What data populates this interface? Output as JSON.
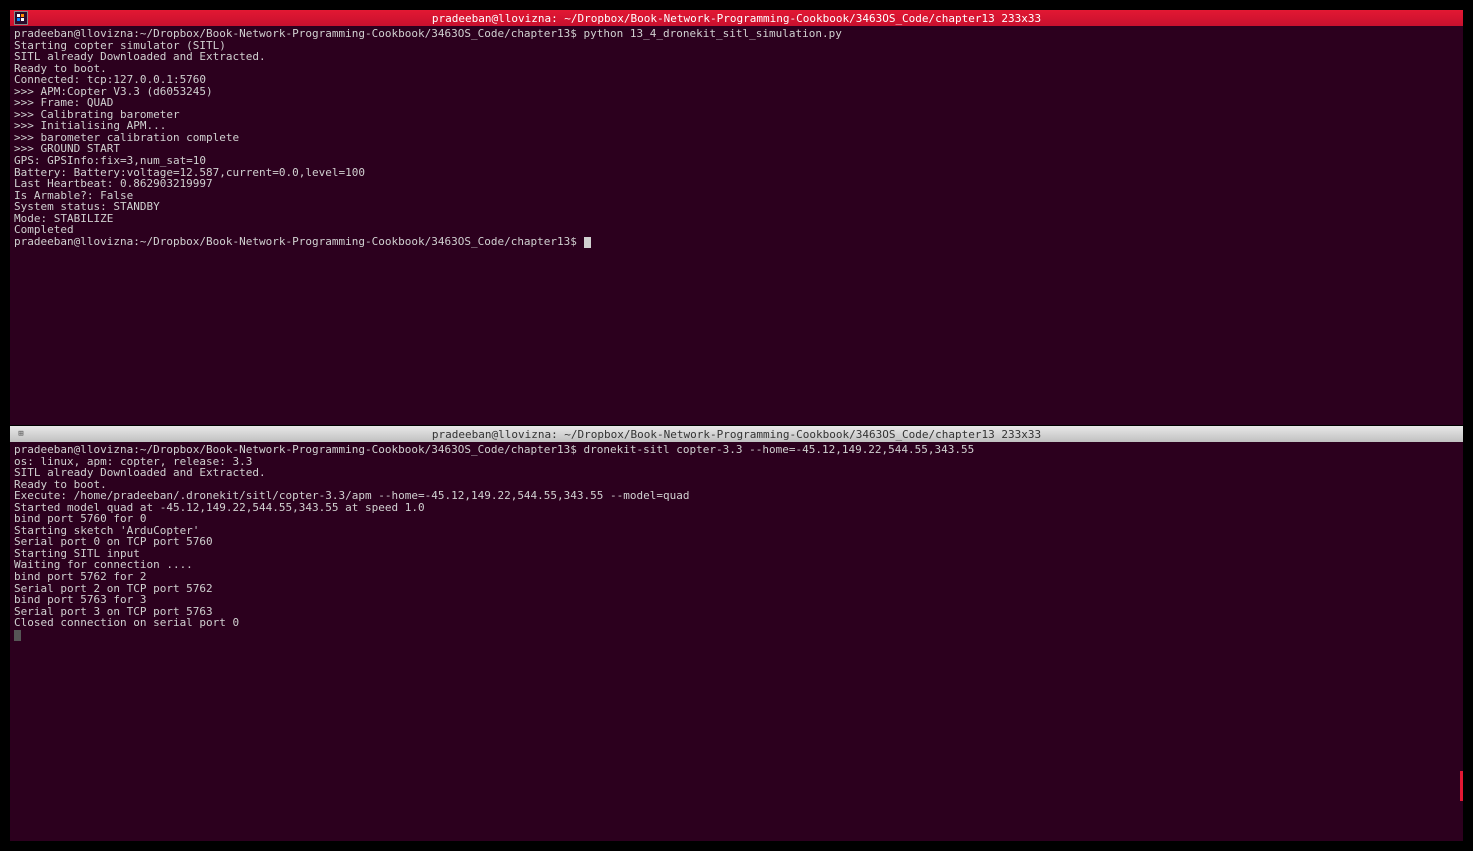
{
  "topPane": {
    "title": "pradeeban@llovizna: ~/Dropbox/Book-Network-Programming-Cookbook/3463OS_Code/chapter13 233x33",
    "promptLine": "pradeeban@llovizna:~/Dropbox/Book-Network-Programming-Cookbook/3463OS_Code/chapter13$ python 13_4_dronekit_sitl_simulation.py",
    "lines": [
      "Starting copter simulator (SITL)",
      "SITL already Downloaded and Extracted.",
      "Ready to boot.",
      "Connected: tcp:127.0.0.1:5760",
      ">>> APM:Copter V3.3 (d6053245)",
      ">>> Frame: QUAD",
      ">>> Calibrating barometer",
      ">>> Initialising APM...",
      ">>> barometer calibration complete",
      ">>> GROUND START",
      "GPS: GPSInfo:fix=3,num_sat=10",
      "Battery: Battery:voltage=12.587,current=0.0,level=100",
      "Last Heartbeat: 0.862903219997",
      "Is Armable?: False",
      "System status: STANDBY",
      "Mode: STABILIZE",
      "Completed"
    ],
    "promptEnd": "pradeeban@llovizna:~/Dropbox/Book-Network-Programming-Cookbook/3463OS_Code/chapter13$ "
  },
  "bottomPane": {
    "title": "pradeeban@llovizna: ~/Dropbox/Book-Network-Programming-Cookbook/3463OS_Code/chapter13 233x33",
    "promptLine": "pradeeban@llovizna:~/Dropbox/Book-Network-Programming-Cookbook/3463OS_Code/chapter13$ dronekit-sitl copter-3.3 --home=-45.12,149.22,544.55,343.55",
    "lines": [
      "os: linux, apm: copter, release: 3.3",
      "SITL already Downloaded and Extracted.",
      "Ready to boot.",
      "Execute: /home/pradeeban/.dronekit/sitl/copter-3.3/apm --home=-45.12,149.22,544.55,343.55 --model=quad",
      "Started model quad at -45.12,149.22,544.55,343.55 at speed 1.0",
      "bind port 5760 for 0",
      "Starting sketch 'ArduCopter'",
      "Serial port 0 on TCP port 5760",
      "Starting SITL input",
      "Waiting for connection ....",
      "bind port 5762 for 2",
      "Serial port 2 on TCP port 5762",
      "bind port 5763 for 3",
      "Serial port 3 on TCP port 5763",
      "Closed connection on serial port 0"
    ]
  },
  "icons": {
    "terminalGlyph": "⊞"
  }
}
